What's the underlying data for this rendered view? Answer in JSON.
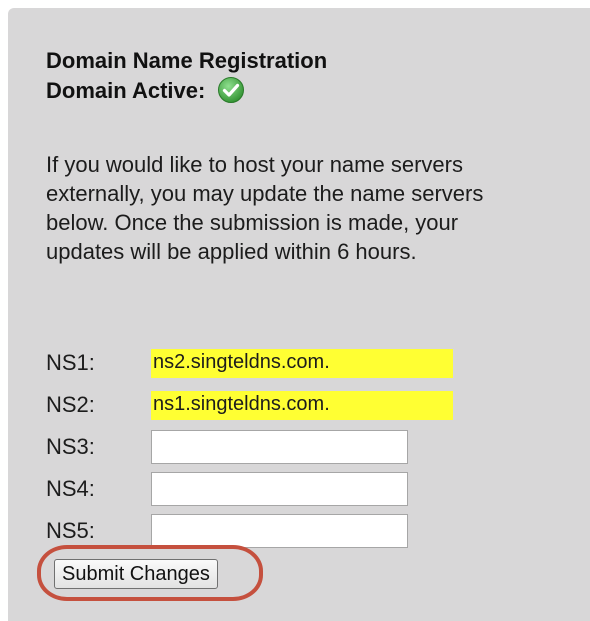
{
  "section": {
    "title": "Domain Name Registration",
    "status_label": "Domain Active:",
    "status_icon": "check-circle-icon",
    "status_color": "#3aa53a",
    "description": "If you would like to host your name servers externally, you may update the name servers below. Once the submission is made, your updates will be applied within 6 hours."
  },
  "nameservers": {
    "ns1": {
      "label": "NS1:",
      "value": "ns2.singteldns.com."
    },
    "ns2": {
      "label": "NS2:",
      "value": "ns1.singteldns.com."
    },
    "ns3": {
      "label": "NS3:",
      "value": ""
    },
    "ns4": {
      "label": "NS4:",
      "value": ""
    },
    "ns5": {
      "label": "NS5:",
      "value": ""
    }
  },
  "actions": {
    "submit_label": "Submit Changes"
  },
  "colors": {
    "panel_background": "#d8d7d8",
    "highlight": "#ffff33",
    "annotation": "#c5503e"
  }
}
